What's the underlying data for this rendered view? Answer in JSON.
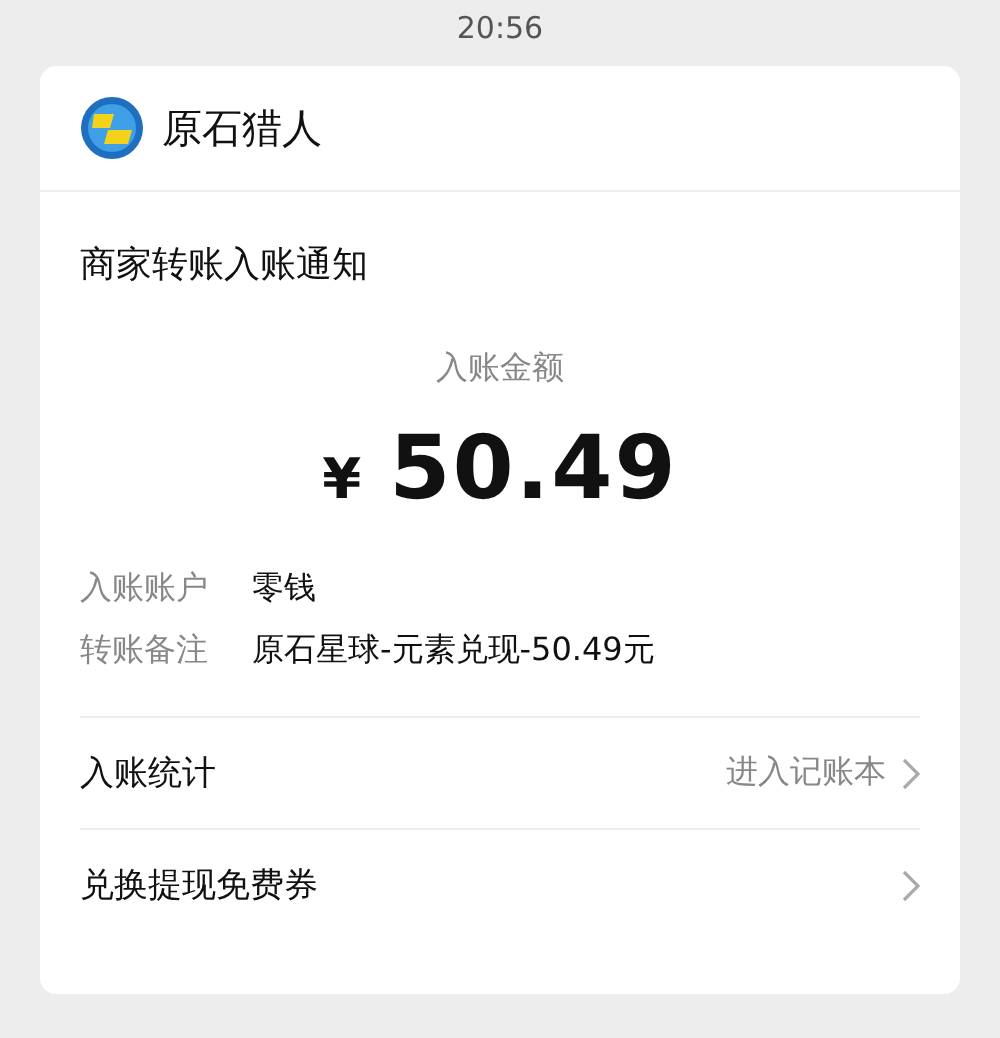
{
  "status_bar": {
    "time": "20:56"
  },
  "sender": {
    "name": "原石猎人"
  },
  "notice": {
    "title": "商家转账入账通知",
    "amount_label": "入账金额",
    "currency": "¥",
    "amount": "50.49",
    "details": [
      {
        "label": "入账账户",
        "value": "零钱"
      },
      {
        "label": "转账备注",
        "value": "原石星球-元素兑现-50.49元"
      }
    ]
  },
  "links": [
    {
      "label": "入账统计",
      "detail": "进入记账本"
    },
    {
      "label": "兑换提现免费券"
    }
  ]
}
